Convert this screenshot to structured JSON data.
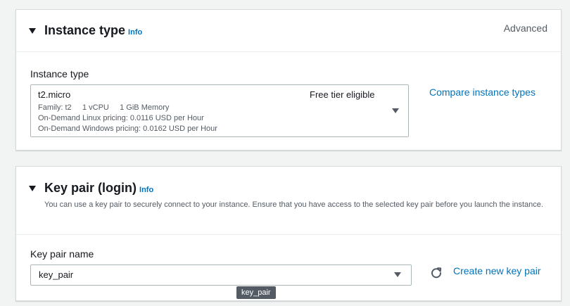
{
  "instance_type_panel": {
    "title": "Instance type",
    "info": "Info",
    "advanced": "Advanced",
    "field_label": "Instance type",
    "selected": {
      "name": "t2.micro",
      "badge": "Free tier eligible",
      "family_line": "Family: t2     1 vCPU     1 GiB Memory",
      "linux_pricing": "On-Demand Linux pricing: 0.0116 USD per Hour",
      "windows_pricing": "On-Demand Windows pricing: 0.0162 USD per Hour"
    },
    "compare_link": "Compare instance types"
  },
  "key_pair_panel": {
    "title": "Key pair (login)",
    "info": "Info",
    "description": "You can use a key pair to securely connect to your instance. Ensure that you have access to the selected key pair before you launch the instance.",
    "field_label": "Key pair name",
    "selected_value": "key_pair",
    "create_link": "Create new key pair",
    "tooltip": "key_pair"
  },
  "colors": {
    "link": "#0073bb",
    "text": "#16191f",
    "secondary_text": "#545b64",
    "background": "#f2f3f3"
  },
  "icons": [
    "caret-down-icon",
    "dropdown-arrow-icon",
    "refresh-icon"
  ]
}
